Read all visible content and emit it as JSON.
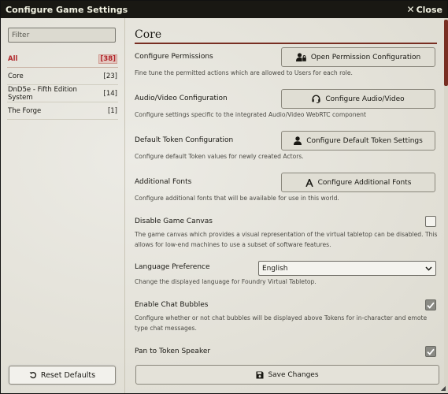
{
  "window": {
    "title": "Configure Game Settings",
    "close_label": "Close"
  },
  "sidebar": {
    "filter_placeholder": "Filter",
    "categories": [
      {
        "label": "All",
        "count": "[38]",
        "active": true
      },
      {
        "label": "Core",
        "count": "[23]"
      },
      {
        "label": "DnD5e - Fifth Edition System",
        "count": "[14]"
      },
      {
        "label": "The Forge",
        "count": "[1]"
      }
    ],
    "reset_label": "Reset Defaults"
  },
  "main": {
    "heading": "Core",
    "settings": {
      "permissions": {
        "label": "Configure Permissions",
        "hint": "Fine tune the permitted actions which are allowed to Users for each role.",
        "button": "Open Permission Configuration"
      },
      "av": {
        "label": "Audio/Video Configuration",
        "hint": "Configure settings specific to the integrated Audio/Video WebRTC component",
        "button": "Configure Audio/Video"
      },
      "token": {
        "label": "Default Token Configuration",
        "hint": "Configure default Token values for newly created Actors.",
        "button": "Configure Default Token Settings"
      },
      "fonts": {
        "label": "Additional Fonts",
        "hint": "Configure additional fonts that will be available for use in this world.",
        "button": "Configure Additional Fonts"
      },
      "canvas": {
        "label": "Disable Game Canvas",
        "hint": "The game canvas which provides a visual representation of the virtual tabletop can be disabled. This allows for low-end machines to use a subset of software features.",
        "checked": false
      },
      "language": {
        "label": "Language Preference",
        "hint": "Change the displayed language for Foundry Virtual Tabletop.",
        "value": "English"
      },
      "bubbles": {
        "label": "Enable Chat Bubbles",
        "hint": "Configure whether or not chat bubbles will be displayed above Tokens for in-character and emote type chat messages.",
        "checked": true
      },
      "pan": {
        "label": "Pan to Token Speaker",
        "checked": true
      }
    },
    "save_label": "Save Changes"
  },
  "colors": {
    "accent": "#782e22",
    "active_category": "#b0262a",
    "titlebar": "#191813"
  },
  "icons": {
    "close": "close-icon",
    "permissions": "user-lock-icon",
    "av": "headset-icon",
    "token": "user-icon",
    "fonts": "font-icon",
    "reset": "undo-icon",
    "save": "save-icon",
    "select": "chevron-down-icon",
    "check": "check-icon"
  }
}
